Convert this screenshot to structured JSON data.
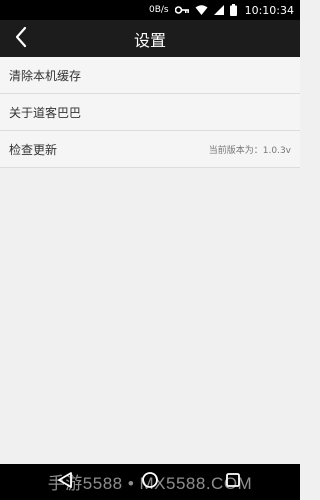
{
  "status_bar": {
    "network_speed": "0B/s",
    "time": "10:10:34",
    "icons": [
      "key-icon",
      "wifi-icon",
      "signal-icon",
      "battery-icon"
    ]
  },
  "header": {
    "title": "设置",
    "back_icon": "chevron-left-icon"
  },
  "settings": {
    "items": [
      {
        "label": "清除本机缓存",
        "value": ""
      },
      {
        "label": "关于道客巴巴",
        "value": ""
      },
      {
        "label": "检查更新",
        "value": "当前版本为：1.0.3v"
      }
    ]
  },
  "nav_bar": {
    "icons": [
      "back-triangle-icon",
      "home-circle-icon",
      "recent-square-icon"
    ]
  },
  "watermark": {
    "text": "手游5588 • MX5588.COM"
  },
  "colors": {
    "header_bg": "#1c1c1c",
    "page_bg": "#f0f0f0",
    "status_bar_bg": "#000000"
  }
}
